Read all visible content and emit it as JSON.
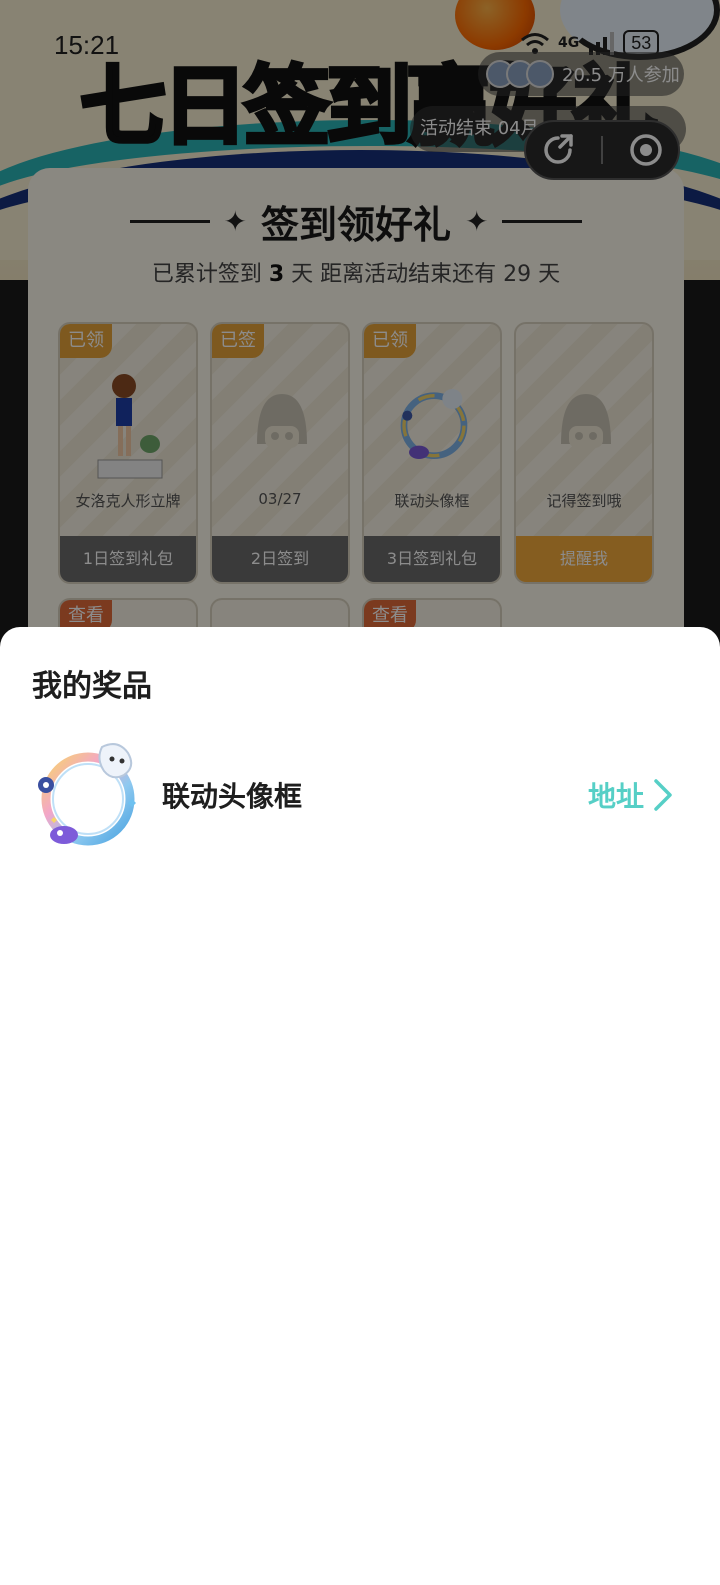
{
  "status_bar": {
    "time": "15:21",
    "network": "4G",
    "battery": "53"
  },
  "banner": {
    "title": "七日签到赢好礼"
  },
  "participants": {
    "text": "20.5 万人参加"
  },
  "activity_end": {
    "text": "活动结束 04月"
  },
  "signin": {
    "title": "签到领好礼",
    "summary_prefix": "已累计签到",
    "summary_days": "3",
    "summary_middle": "天  距离活动结束还有 29 天",
    "days": [
      {
        "tag": "已领",
        "name": "女洛克人形立牌",
        "footer": "1日签到礼包"
      },
      {
        "tag": "已签",
        "name": "03/27",
        "footer": "2日签到"
      },
      {
        "tag": "已领",
        "name": "联动头像框",
        "footer": "3日签到礼包"
      },
      {
        "tag": "",
        "name": "记得签到哦",
        "footer": "提醒我"
      }
    ],
    "row2_tags": [
      "查看",
      "",
      "查看"
    ]
  },
  "sheet": {
    "title": "我的奖品",
    "prizes": [
      {
        "name": "联动头像框",
        "action": "地址"
      }
    ]
  },
  "colors": {
    "accent": "#56cfc6",
    "tag_orange": "#e5a23a",
    "remind_orange": "#f2a93b"
  }
}
